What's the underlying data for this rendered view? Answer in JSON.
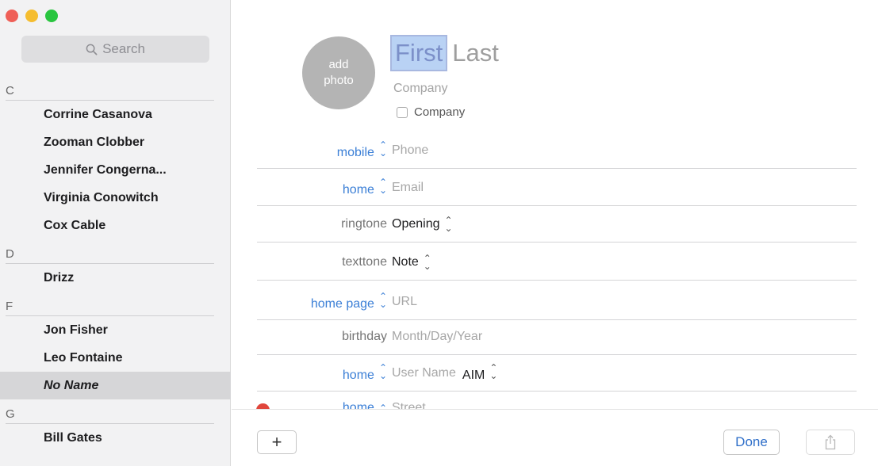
{
  "window": {
    "controls": [
      "close",
      "minimize",
      "zoom"
    ]
  },
  "sidebar": {
    "search": {
      "placeholder": "Search",
      "icon": "search-icon"
    },
    "sections": [
      {
        "letter": "C",
        "contacts": [
          "Corrine Casanova",
          "Zooman Clobber",
          "Jennifer Congerna...",
          "Virginia Conowitch",
          "Cox Cable"
        ]
      },
      {
        "letter": "D",
        "contacts": [
          "Drizz"
        ]
      },
      {
        "letter": "F",
        "contacts": [
          "Jon Fisher",
          "Leo Fontaine",
          "No Name"
        ]
      },
      {
        "letter": "G",
        "contacts": [
          "Bill Gates"
        ]
      }
    ],
    "selected": "No Name"
  },
  "card": {
    "avatar": {
      "line1": "add",
      "line2": "photo"
    },
    "first_name": "First",
    "last_name": "Last",
    "company_placeholder": "Company",
    "company_checkbox_label": "Company",
    "fields": [
      {
        "label": "mobile",
        "value": "Phone"
      },
      {
        "label": "home",
        "value": "Email"
      },
      {
        "label": "ringtone",
        "value": "Opening"
      },
      {
        "label": "texttone",
        "value": "Note"
      },
      {
        "label": "home page",
        "value": "URL"
      },
      {
        "label": "birthday",
        "value": "Month/Day/Year"
      },
      {
        "label": "home",
        "value": "User Name",
        "service": "AIM"
      },
      {
        "label": "home",
        "value": "Street"
      }
    ]
  },
  "toolbar": {
    "add_label": "+",
    "done_label": "Done",
    "share_icon": "share-icon"
  },
  "colors": {
    "accent_blue": "#3b7fd6",
    "close": "#ef5f57",
    "minimize": "#f5bd2f",
    "zoom": "#29c53f",
    "delete": "#e0463c"
  }
}
